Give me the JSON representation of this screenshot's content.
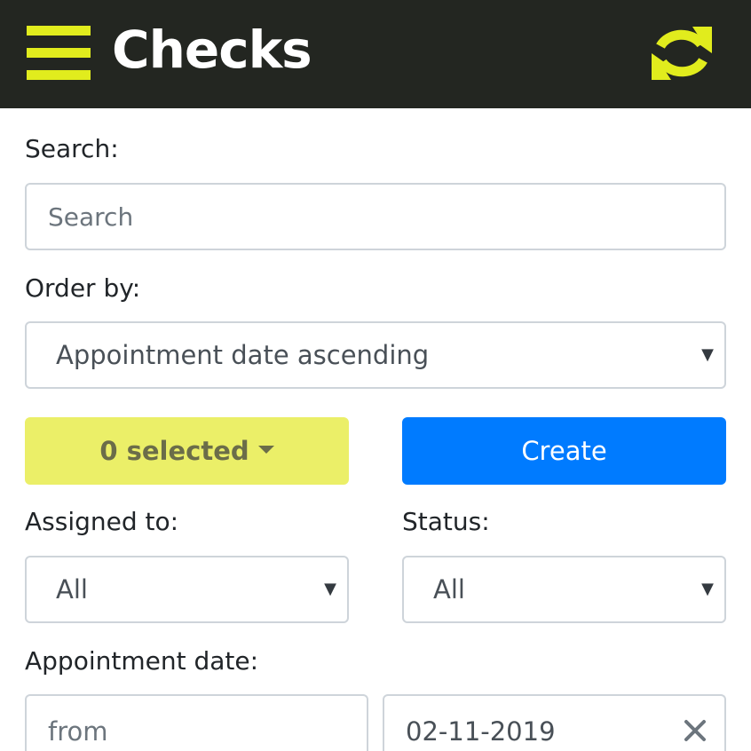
{
  "header": {
    "title": "Checks",
    "menu_icon": "hamburger-menu-icon",
    "refresh_icon": "refresh-icon",
    "background": "#232621",
    "accent": "#e1ec1d"
  },
  "search": {
    "label": "Search:",
    "placeholder": "Search",
    "value": ""
  },
  "order_by": {
    "label": "Order by:",
    "selected": "Appointment date ascending"
  },
  "actions": {
    "selected_label": "0 selected",
    "create_label": "Create"
  },
  "filters": {
    "assigned_to": {
      "label": "Assigned to:",
      "selected": "All"
    },
    "status": {
      "label": "Status:",
      "selected": "All"
    }
  },
  "appointment_date": {
    "label": "Appointment date:",
    "from_placeholder": "from",
    "to_value": "02-11-2019"
  },
  "colors": {
    "create_button": "#007bff",
    "selected_button": "#ebef68"
  }
}
